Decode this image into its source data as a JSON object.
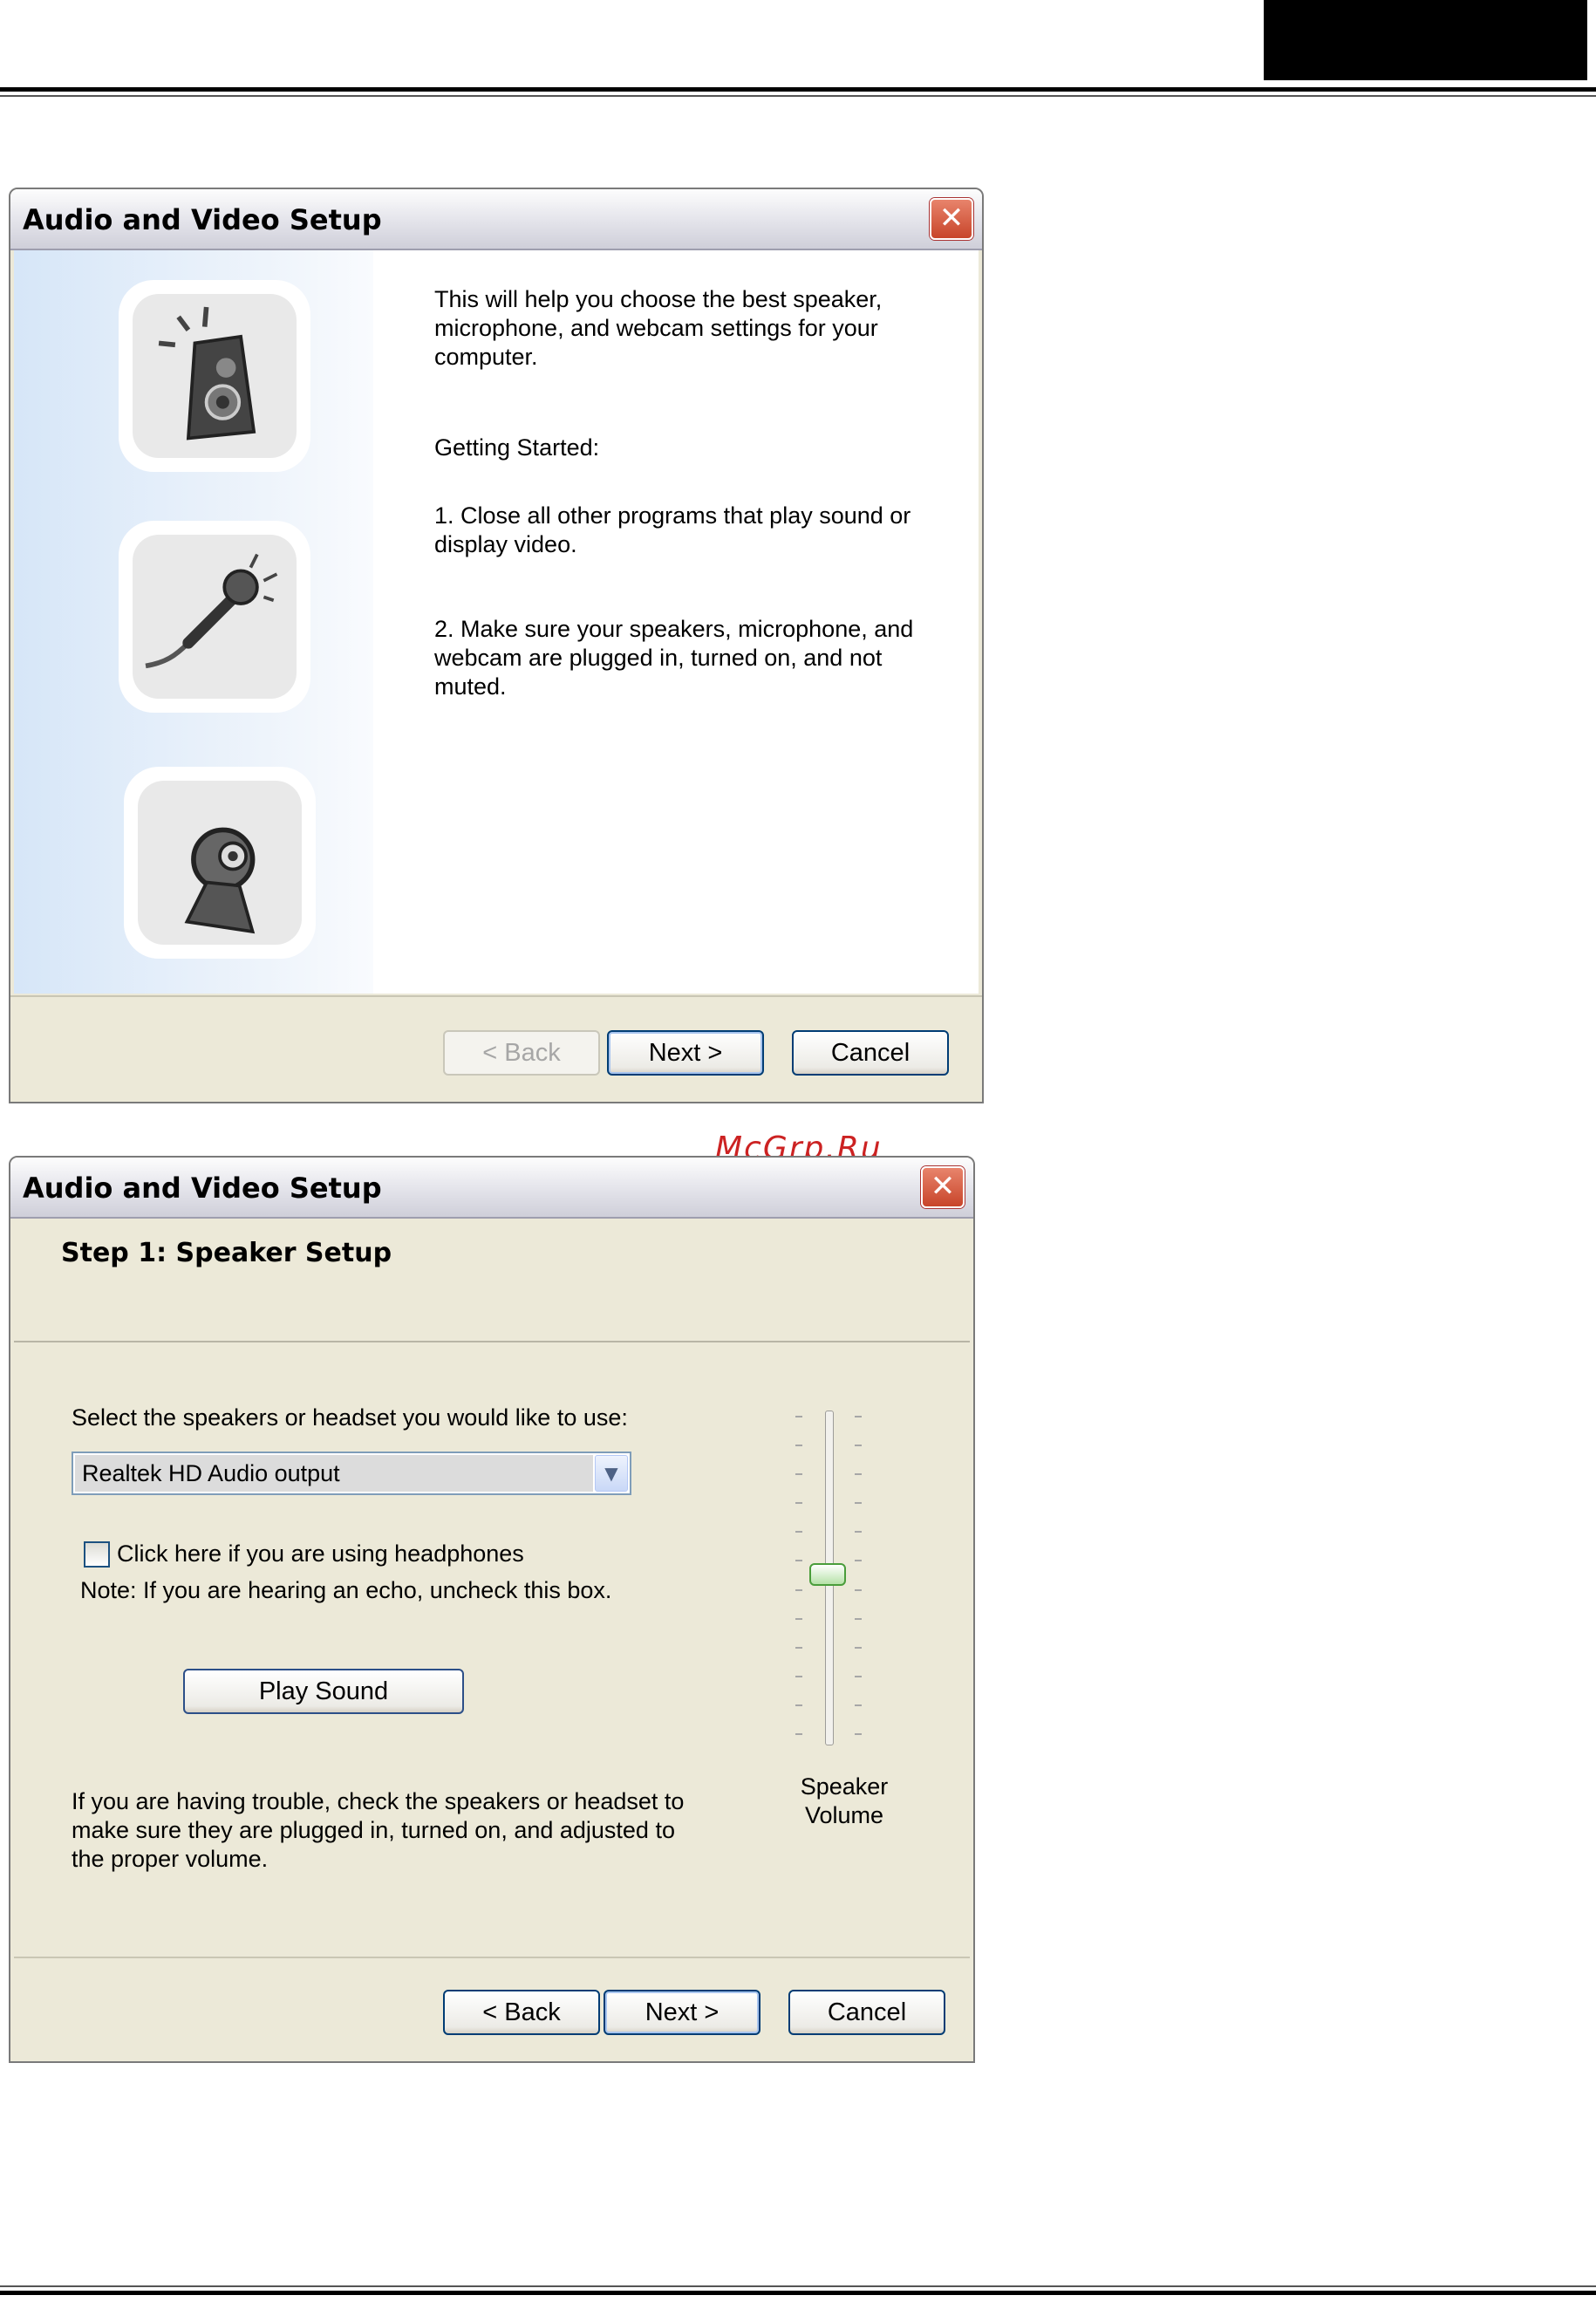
{
  "watermark": "McGrp.Ru",
  "dialog_intro": {
    "title": "Audio and Video Setup",
    "close_glyph": "✕",
    "icons": [
      "speaker-icon",
      "microphone-icon",
      "webcam-icon"
    ],
    "paragraph1": "This will help you choose the best speaker, microphone, and webcam settings for your computer.",
    "getting_started": "Getting Started:",
    "step1": "1. Close all other programs that play sound or display video.",
    "step2": "2. Make sure your speakers, microphone, and webcam are plugged in, turned on, and not muted.",
    "buttons": {
      "back": "< Back",
      "next": "Next >",
      "cancel": "Cancel"
    }
  },
  "dialog_speaker": {
    "title": "Audio and Video Setup",
    "close_glyph": "✕",
    "step_title": "Step 1: Speaker Setup",
    "select_label": "Select the speakers or headset you would like to use:",
    "device_selected": "Realtek HD Audio output",
    "dropdown_glyph": "▼",
    "headphones_checkbox": "Click here if you are using headphones",
    "headphones_checked": false,
    "note": "Note: If you are hearing an echo, uncheck this box.",
    "play_sound": "Play Sound",
    "trouble_text": "If you are having trouble, check the speakers or headset to make sure they are plugged in, turned on, and adjusted to the proper volume.",
    "volume_label": "Speaker Volume",
    "volume_level": 0.5,
    "buttons": {
      "back": "< Back",
      "next": "Next >",
      "cancel": "Cancel"
    }
  }
}
